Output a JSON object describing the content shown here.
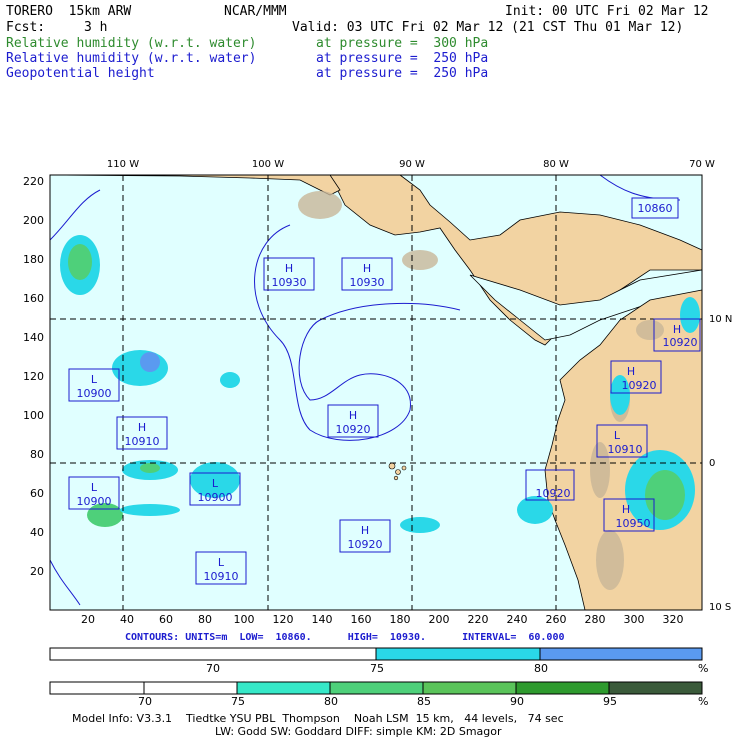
{
  "header": {
    "model": "TORERO  15km ARW",
    "org": "NCAR/MMM",
    "init": "Init: 00 UTC Fri 02 Mar 12",
    "fcst_label": "Fcst:",
    "fcst_value": "3 h",
    "valid": "Valid: 03 UTC Fri 02 Mar 12 (21 CST Thu 01 Mar 12)",
    "fields": [
      {
        "name": "Relative humidity (w.r.t. water)",
        "level": "at pressure =  300 hPa",
        "color": "#2e8b2e"
      },
      {
        "name": "Relative humidity (w.r.t. water)",
        "level": "at pressure =  250 hPa",
        "color": "#1c1ccf"
      },
      {
        "name": "Geopotential height",
        "level": "at pressure =  250 hPa",
        "color": "#1c1ccf"
      }
    ]
  },
  "map": {
    "top_lon_labels": [
      "110 W",
      "100 W",
      "90 W",
      "80 W",
      "70 W"
    ],
    "left_y_ticks": [
      "220",
      "200",
      "180",
      "160",
      "140",
      "120",
      "100",
      "80",
      "60",
      "40",
      "20"
    ],
    "bottom_x_ticks": [
      "20",
      "40",
      "60",
      "80",
      "100",
      "120",
      "140",
      "160",
      "180",
      "200",
      "220",
      "240",
      "260",
      "280",
      "300",
      "320"
    ],
    "right_lat_labels": [
      "10 N",
      "0",
      "10 S"
    ],
    "centers": [
      {
        "type": "H",
        "value": "10930"
      },
      {
        "type": "H",
        "value": "10930"
      },
      {
        "type": "L",
        "value": "10900"
      },
      {
        "type": "H",
        "value": "10910"
      },
      {
        "type": "H",
        "value": "10920"
      },
      {
        "type": "L",
        "value": "10900"
      },
      {
        "type": "L",
        "value": "10900"
      },
      {
        "type": "H",
        "value": "10920"
      },
      {
        "type": "L",
        "value": "10910"
      },
      {
        "type": "",
        "value": "10860"
      },
      {
        "type": "H",
        "value": "10920"
      },
      {
        "type": "H",
        "value": "10920"
      },
      {
        "type": "L",
        "value": "10910"
      },
      {
        "type": "",
        "value": "10920"
      },
      {
        "type": "H",
        "value": "10950"
      }
    ],
    "colors": {
      "ocean": "#e0ffff",
      "land": "#f2d3a2",
      "contour": "#1c1ccf",
      "grid": "#000000"
    }
  },
  "contours": {
    "text": "CONTOURS: UNITS=m  LOW=  10860.      HIGH=  10930.      INTERVAL=  60.000"
  },
  "colorbar_250": {
    "labels": [
      "70",
      "75",
      "80",
      "%"
    ],
    "colors": [
      "#ffffff",
      "#2ad8e8",
      "#5a9af0"
    ]
  },
  "colorbar_300": {
    "labels": [
      "70",
      "75",
      "80",
      "85",
      "90",
      "95",
      "%"
    ],
    "colors": [
      "#ffffff",
      "#ffffff",
      "#36e8c8",
      "#4ed07a",
      "#5ac45a",
      "#2e9a2e",
      "#3a5a3a"
    ]
  },
  "footer": {
    "line1": "Model Info: V3.3.1    Tiedtke YSU PBL  Thompson    Noah LSM  15 km,   44 levels,   74 sec",
    "line2": "LW: Godd SW: Goddard DIFF: simple KM: 2D Smagor"
  }
}
